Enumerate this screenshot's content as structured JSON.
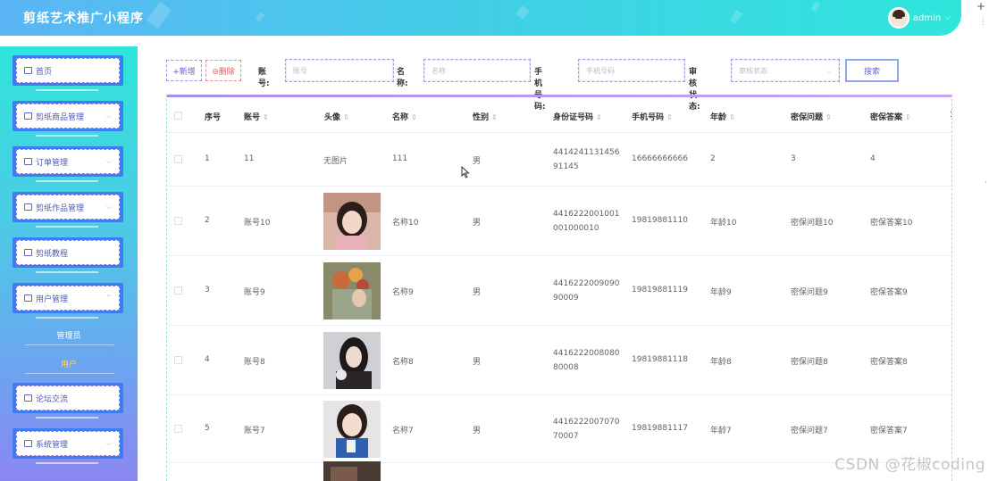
{
  "header": {
    "app_title": "剪纸艺术推广小程序",
    "user_name": "admin",
    "user_chevron": "⌵"
  },
  "corner": {
    "plus": "+",
    "dots": "⋮"
  },
  "sidebar": {
    "items": [
      {
        "label": "首页",
        "icon": "home-icon",
        "has_chevron": false,
        "chevron": ""
      },
      {
        "label": "剪纸商品管理",
        "icon": "shop-icon",
        "has_chevron": true,
        "chevron": "⌵"
      },
      {
        "label": "订单管理",
        "icon": "order-icon",
        "has_chevron": true,
        "chevron": "⌵"
      },
      {
        "label": "剪纸作品管理",
        "icon": "folder-icon",
        "has_chevron": true,
        "chevron": "⌵"
      },
      {
        "label": "剪纸教程",
        "icon": "book-icon",
        "has_chevron": false,
        "chevron": ""
      },
      {
        "label": "用户管理",
        "icon": "user-icon",
        "has_chevron": true,
        "chevron": "⌃"
      },
      {
        "label": "论坛交流",
        "icon": "forum-icon",
        "has_chevron": false,
        "chevron": ""
      },
      {
        "label": "系统管理",
        "icon": "system-icon",
        "has_chevron": true,
        "chevron": "⌵"
      }
    ],
    "sub_items": [
      {
        "label": "管理员",
        "active": false
      },
      {
        "label": "用户",
        "active": true
      }
    ]
  },
  "toolbar": {
    "add_label": "+新增",
    "delete_label": "⊖删除",
    "search_fields": [
      {
        "label": "账号:",
        "placeholder": "账号"
      },
      {
        "label": "名称:",
        "placeholder": "名称"
      },
      {
        "label": "手机号码:",
        "placeholder": "手机号码"
      },
      {
        "label": "审核状态:",
        "placeholder": "审核状态"
      }
    ],
    "select_arrow": "⌵",
    "search_button": "搜索"
  },
  "table": {
    "sort_icon": "⇕",
    "columns": [
      "序号",
      "账号",
      "头像",
      "名称",
      "性别",
      "身份证号码",
      "手机号码",
      "年龄",
      "密保问题",
      "密保答案"
    ],
    "sortable": [
      false,
      true,
      true,
      true,
      true,
      true,
      true,
      true,
      true,
      true
    ],
    "overflow_col_fragment": "1",
    "rows": [
      {
        "index": "1",
        "account": "11",
        "avatar": "无图片",
        "has_photo": false,
        "name": "111",
        "gender": "男",
        "id_card": "441424113145691145",
        "phone": "16666666666",
        "age": "2",
        "question": "3",
        "answer": "4"
      },
      {
        "index": "2",
        "account": "账号10",
        "avatar": "",
        "has_photo": true,
        "name": "名称10",
        "gender": "男",
        "id_card": "4416222001001001000010",
        "phone": "19819881110",
        "age": "年龄10",
        "question": "密保问题10",
        "answer": "密保答案10"
      },
      {
        "index": "3",
        "account": "账号9",
        "avatar": "",
        "has_photo": true,
        "name": "名称9",
        "gender": "男",
        "id_card": "441622200909090009",
        "phone": "19819881119",
        "age": "年龄9",
        "question": "密保问题9",
        "answer": "密保答案9"
      },
      {
        "index": "4",
        "account": "账号8",
        "avatar": "",
        "has_photo": true,
        "name": "名称8",
        "gender": "男",
        "id_card": "441622200808080008",
        "phone": "19819881118",
        "age": "年龄8",
        "question": "密保问题8",
        "answer": "密保答案8"
      },
      {
        "index": "5",
        "account": "账号7",
        "avatar": "",
        "has_photo": true,
        "name": "名称7",
        "gender": "男",
        "id_card": "441622200707070007",
        "phone": "19819881117",
        "age": "年龄7",
        "question": "密保问题7",
        "answer": "密保答案7"
      }
    ]
  },
  "watermark": "CSDN @花椒coding",
  "colors": {
    "accent": "#3d7cf2",
    "header_start": "#5bb6f5",
    "header_end": "#2ee6dc",
    "active_sub": "#ffd35c"
  }
}
